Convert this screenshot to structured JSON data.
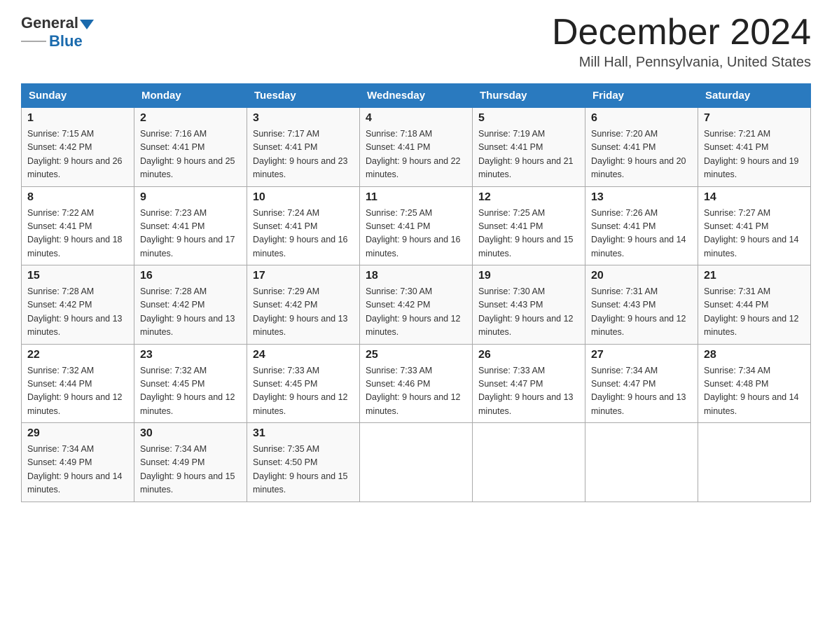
{
  "header": {
    "logo_general": "General",
    "logo_blue": "Blue",
    "month_title": "December 2024",
    "location": "Mill Hall, Pennsylvania, United States"
  },
  "weekdays": [
    "Sunday",
    "Monday",
    "Tuesday",
    "Wednesday",
    "Thursday",
    "Friday",
    "Saturday"
  ],
  "weeks": [
    [
      {
        "day": "1",
        "sunrise": "7:15 AM",
        "sunset": "4:42 PM",
        "daylight": "9 hours and 26 minutes."
      },
      {
        "day": "2",
        "sunrise": "7:16 AM",
        "sunset": "4:41 PM",
        "daylight": "9 hours and 25 minutes."
      },
      {
        "day": "3",
        "sunrise": "7:17 AM",
        "sunset": "4:41 PM",
        "daylight": "9 hours and 23 minutes."
      },
      {
        "day": "4",
        "sunrise": "7:18 AM",
        "sunset": "4:41 PM",
        "daylight": "9 hours and 22 minutes."
      },
      {
        "day": "5",
        "sunrise": "7:19 AM",
        "sunset": "4:41 PM",
        "daylight": "9 hours and 21 minutes."
      },
      {
        "day": "6",
        "sunrise": "7:20 AM",
        "sunset": "4:41 PM",
        "daylight": "9 hours and 20 minutes."
      },
      {
        "day": "7",
        "sunrise": "7:21 AM",
        "sunset": "4:41 PM",
        "daylight": "9 hours and 19 minutes."
      }
    ],
    [
      {
        "day": "8",
        "sunrise": "7:22 AM",
        "sunset": "4:41 PM",
        "daylight": "9 hours and 18 minutes."
      },
      {
        "day": "9",
        "sunrise": "7:23 AM",
        "sunset": "4:41 PM",
        "daylight": "9 hours and 17 minutes."
      },
      {
        "day": "10",
        "sunrise": "7:24 AM",
        "sunset": "4:41 PM",
        "daylight": "9 hours and 16 minutes."
      },
      {
        "day": "11",
        "sunrise": "7:25 AM",
        "sunset": "4:41 PM",
        "daylight": "9 hours and 16 minutes."
      },
      {
        "day": "12",
        "sunrise": "7:25 AM",
        "sunset": "4:41 PM",
        "daylight": "9 hours and 15 minutes."
      },
      {
        "day": "13",
        "sunrise": "7:26 AM",
        "sunset": "4:41 PM",
        "daylight": "9 hours and 14 minutes."
      },
      {
        "day": "14",
        "sunrise": "7:27 AM",
        "sunset": "4:41 PM",
        "daylight": "9 hours and 14 minutes."
      }
    ],
    [
      {
        "day": "15",
        "sunrise": "7:28 AM",
        "sunset": "4:42 PM",
        "daylight": "9 hours and 13 minutes."
      },
      {
        "day": "16",
        "sunrise": "7:28 AM",
        "sunset": "4:42 PM",
        "daylight": "9 hours and 13 minutes."
      },
      {
        "day": "17",
        "sunrise": "7:29 AM",
        "sunset": "4:42 PM",
        "daylight": "9 hours and 13 minutes."
      },
      {
        "day": "18",
        "sunrise": "7:30 AM",
        "sunset": "4:42 PM",
        "daylight": "9 hours and 12 minutes."
      },
      {
        "day": "19",
        "sunrise": "7:30 AM",
        "sunset": "4:43 PM",
        "daylight": "9 hours and 12 minutes."
      },
      {
        "day": "20",
        "sunrise": "7:31 AM",
        "sunset": "4:43 PM",
        "daylight": "9 hours and 12 minutes."
      },
      {
        "day": "21",
        "sunrise": "7:31 AM",
        "sunset": "4:44 PM",
        "daylight": "9 hours and 12 minutes."
      }
    ],
    [
      {
        "day": "22",
        "sunrise": "7:32 AM",
        "sunset": "4:44 PM",
        "daylight": "9 hours and 12 minutes."
      },
      {
        "day": "23",
        "sunrise": "7:32 AM",
        "sunset": "4:45 PM",
        "daylight": "9 hours and 12 minutes."
      },
      {
        "day": "24",
        "sunrise": "7:33 AM",
        "sunset": "4:45 PM",
        "daylight": "9 hours and 12 minutes."
      },
      {
        "day": "25",
        "sunrise": "7:33 AM",
        "sunset": "4:46 PM",
        "daylight": "9 hours and 12 minutes."
      },
      {
        "day": "26",
        "sunrise": "7:33 AM",
        "sunset": "4:47 PM",
        "daylight": "9 hours and 13 minutes."
      },
      {
        "day": "27",
        "sunrise": "7:34 AM",
        "sunset": "4:47 PM",
        "daylight": "9 hours and 13 minutes."
      },
      {
        "day": "28",
        "sunrise": "7:34 AM",
        "sunset": "4:48 PM",
        "daylight": "9 hours and 14 minutes."
      }
    ],
    [
      {
        "day": "29",
        "sunrise": "7:34 AM",
        "sunset": "4:49 PM",
        "daylight": "9 hours and 14 minutes."
      },
      {
        "day": "30",
        "sunrise": "7:34 AM",
        "sunset": "4:49 PM",
        "daylight": "9 hours and 15 minutes."
      },
      {
        "day": "31",
        "sunrise": "7:35 AM",
        "sunset": "4:50 PM",
        "daylight": "9 hours and 15 minutes."
      },
      null,
      null,
      null,
      null
    ]
  ],
  "labels": {
    "sunrise": "Sunrise:",
    "sunset": "Sunset:",
    "daylight": "Daylight:"
  }
}
